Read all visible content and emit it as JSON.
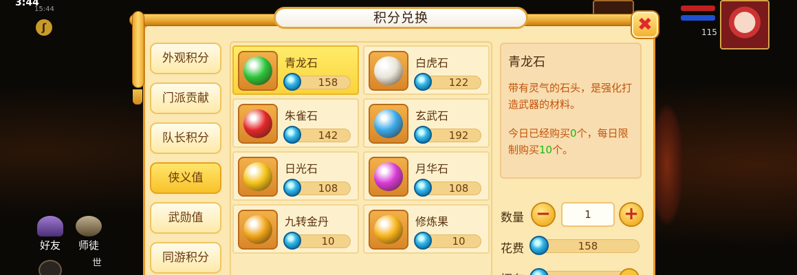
{
  "status": {
    "time": "3:44",
    "sub": "15:44"
  },
  "bottom_left": {
    "friends_label": "好友",
    "master_label": "师徒",
    "world_label": "世"
  },
  "player": {
    "level": "115"
  },
  "dialog": {
    "title": "积分兑换",
    "close_icon": "close-icon",
    "tabs": [
      {
        "label": "外观积分",
        "active": false
      },
      {
        "label": "门派贡献",
        "active": false
      },
      {
        "label": "队长积分",
        "active": false
      },
      {
        "label": "侠义值",
        "active": true
      },
      {
        "label": "武勋值",
        "active": false
      },
      {
        "label": "同游积分",
        "active": false
      }
    ],
    "items": [
      {
        "name": "青龙石",
        "price": "158",
        "icon": "green-dragon-stone-icon",
        "color": "#2cc43a",
        "selected": true
      },
      {
        "name": "白虎石",
        "price": "122",
        "icon": "white-tiger-stone-icon",
        "color": "#e8e4d8",
        "selected": false
      },
      {
        "name": "朱雀石",
        "price": "142",
        "icon": "vermilion-bird-stone-icon",
        "color": "#e2262a",
        "selected": false
      },
      {
        "name": "玄武石",
        "price": "192",
        "icon": "black-tortoise-stone-icon",
        "color": "#3aa8e8",
        "selected": false
      },
      {
        "name": "日光石",
        "price": "108",
        "icon": "sunlight-stone-icon",
        "color": "#f4c21a",
        "selected": false
      },
      {
        "name": "月华石",
        "price": "108",
        "icon": "moonlight-stone-icon",
        "color": "#d83ad6",
        "selected": false
      },
      {
        "name": "九转金丹",
        "price": "10",
        "icon": "golden-elixir-icon",
        "color": "#f0a418",
        "selected": false
      },
      {
        "name": "修炼果",
        "price": "10",
        "icon": "cultivation-fruit-icon",
        "color": "#f7b21a",
        "selected": false
      }
    ],
    "detail": {
      "name": "青龙石",
      "description": "带有灵气的石头，是强化打造武器的材料。",
      "limit_pre": "今日已经购买",
      "limit_bought": "0",
      "limit_mid": "个，每日限制购买",
      "limit_max": "10",
      "limit_post": "个。"
    },
    "quantity": {
      "label": "数量",
      "value": "1",
      "minus": "−",
      "plus": "+"
    },
    "cost": {
      "label": "花费",
      "value": "158"
    },
    "owned": {
      "label": "拥有"
    }
  }
}
